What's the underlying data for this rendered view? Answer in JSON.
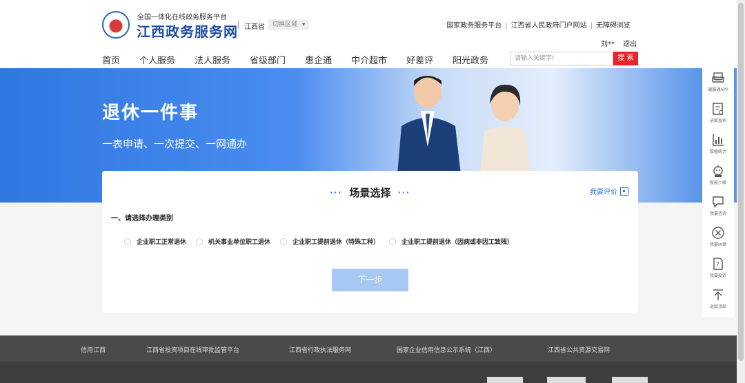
{
  "header": {
    "platform_sub": "全国一体化在线政务服务平台",
    "platform_main": "江西政务服务网",
    "province": "江西省",
    "switch_region": "切换区域",
    "top_links": [
      "国家政务服务平台",
      "江西省人民政府门户网站",
      "无障碍浏览"
    ],
    "user_name": "刘**",
    "logout": "退出"
  },
  "nav": {
    "items": [
      "首页",
      "个人服务",
      "法人服务",
      "省级部门",
      "惠企通",
      "中介超市",
      "好差评",
      "阳光政务"
    ],
    "search_placeholder": "请输入关键字!",
    "search_button": "搜 索"
  },
  "banner": {
    "title": "退休一件事",
    "subtitle": "一表申请、一次提交、一网通办"
  },
  "card": {
    "title": "场景选择",
    "evaluate": "我要评价",
    "section_label": "一、请选择办理类别",
    "options": [
      "企业职工正常退休",
      "机关事业单位职工退休",
      "企业职工提前退休（特殊工种）",
      "企业职工提前退休（因病或非因工致残）"
    ],
    "next_button": "下一步"
  },
  "sidebar": {
    "items": [
      {
        "label": "赣服通APP",
        "icon": "phone-app-icon"
      },
      {
        "label": "进度查询",
        "icon": "progress-query-icon"
      },
      {
        "label": "数据统计",
        "icon": "statistics-icon"
      },
      {
        "label": "智能小赣",
        "icon": "robot-icon"
      },
      {
        "label": "我要咨询",
        "icon": "consult-icon"
      },
      {
        "label": "我要纠错",
        "icon": "error-correction-icon"
      },
      {
        "label": "我要投诉",
        "icon": "complaint-icon"
      },
      {
        "label": "返回顶部",
        "icon": "back-to-top-icon"
      }
    ]
  },
  "footer": {
    "links": [
      "信用江西",
      "江西省投资项目在线审批监管平台",
      "江西省行政执法服务网",
      "国家企业信用信息公示系统（江西）",
      "江西省公共资源交易网"
    ]
  },
  "colors": {
    "brand_blue": "#2f78e0",
    "search_red": "#e6242b",
    "button_disabled_blue": "#a7c8f3",
    "footer_gray": "#4a4a4a"
  }
}
